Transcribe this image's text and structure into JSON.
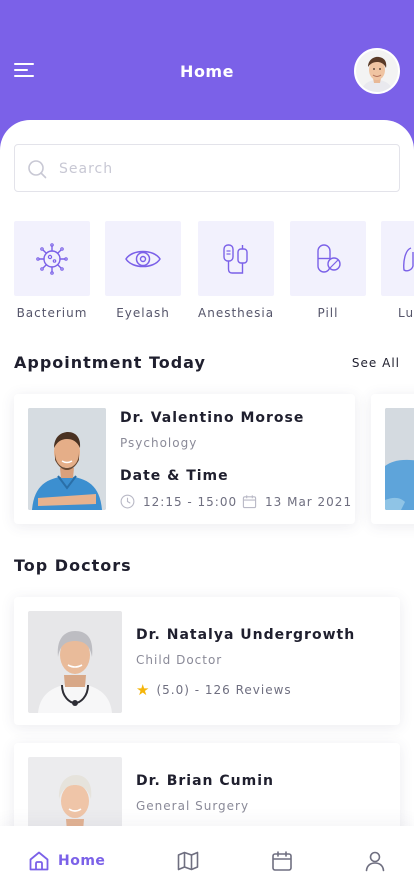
{
  "header": {
    "title": "Home",
    "menu_icon": "hamburger-menu-icon",
    "avatar": "user-avatar"
  },
  "search": {
    "placeholder": "Search",
    "icon": "search-icon"
  },
  "categories": [
    {
      "label": "Bacterium",
      "icon": "bacterium-icon"
    },
    {
      "label": "Eyelash",
      "icon": "eye-icon"
    },
    {
      "label": "Anesthesia",
      "icon": "iv-bag-icon"
    },
    {
      "label": "Pill",
      "icon": "pill-icon"
    },
    {
      "label": "Lu",
      "icon": "lungs-icon"
    }
  ],
  "appointment": {
    "section_title": "Appointment Today",
    "see_all": "See All",
    "cards": [
      {
        "name": "Dr. Valentino Morose",
        "specialty": "Psychology",
        "datetime_label": "Date & Time",
        "time": "12:15 - 15:00",
        "date": "13 Mar 2021"
      }
    ]
  },
  "top_doctors": {
    "section_title": "Top Doctors",
    "doctors": [
      {
        "name": "Dr. Natalya Undergrowth",
        "specialty": "Child Doctor",
        "rating": "(5.0) - 126 Reviews"
      },
      {
        "name": "Dr. Brian Cumin",
        "specialty": "General Surgery"
      }
    ]
  },
  "bottom_nav": {
    "items": [
      {
        "label": "Home",
        "icon": "home-icon",
        "active": true
      },
      {
        "label": "",
        "icon": "map-icon",
        "active": false
      },
      {
        "label": "",
        "icon": "calendar-icon",
        "active": false
      },
      {
        "label": "",
        "icon": "profile-icon",
        "active": false
      }
    ]
  },
  "colors": {
    "primary": "#7B61E8",
    "category_bg": "#F2F1FD",
    "star": "#F5B50A"
  }
}
